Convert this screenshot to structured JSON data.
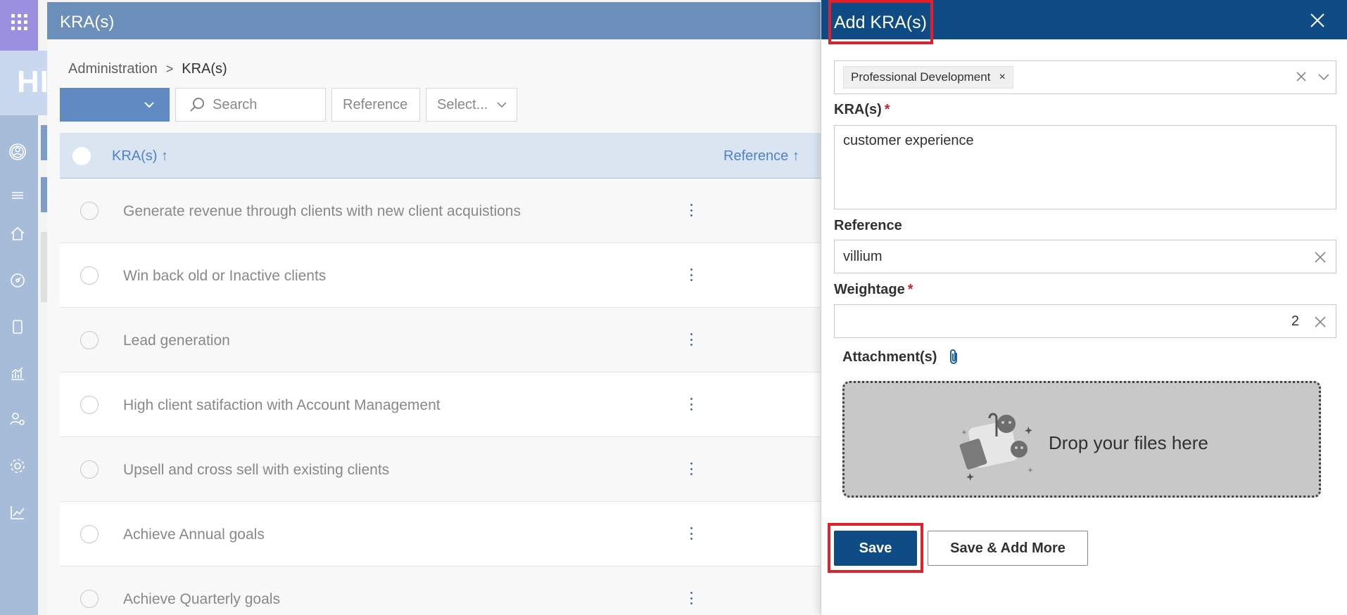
{
  "app": {
    "page_title": "KRA(s)",
    "logo_partial": "HI"
  },
  "breadcrumb": {
    "parent": "Administration",
    "separator": ">",
    "current": "KRA(s)"
  },
  "toolbar": {
    "search_placeholder": "Search",
    "reference_filter": "Reference",
    "select_filter": "Select..."
  },
  "table": {
    "columns": {
      "kra": "KRA(s) ↑",
      "reference": "Reference ↑"
    },
    "rows": [
      "Generate revenue through clients with new client acquistions",
      "Win back old or Inactive clients",
      "Lead generation",
      "High client satifaction with Account Management",
      "Upsell and cross sell with existing clients",
      "Achieve Annual goals",
      "Achieve Quarterly goals"
    ]
  },
  "panel": {
    "title": "Add KRA(s)",
    "category_tag": "Professional Development",
    "tag_remove": "×",
    "kra_label": "KRA(s)",
    "kra_value": "customer experience",
    "reference_label": "Reference",
    "reference_value": "villium",
    "weightage_label": "Weightage",
    "weightage_value": "2",
    "required_mark": "*",
    "attachments_label": "Attachment(s)",
    "dropzone_text": "Drop your files here",
    "save_label": "Save",
    "save_add_more_label": "Save & Add More"
  },
  "colors": {
    "header_blue": "#0f4c86",
    "page_header": "#6b8fba",
    "highlight_red": "#e0202b",
    "link_blue": "#4f82c8"
  }
}
